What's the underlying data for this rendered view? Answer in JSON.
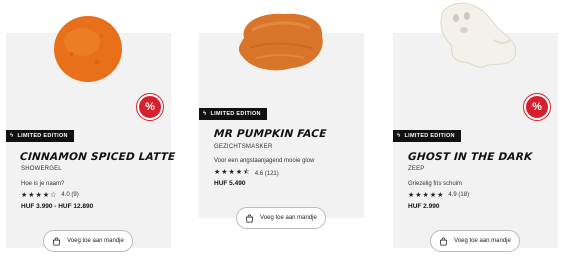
{
  "products": [
    {
      "edition": "LIMITED EDITION",
      "title": "CINNAMON SPICED LATTE",
      "category": "SHOWERGEL",
      "description": "Hoe is je naam?",
      "stars": 4,
      "rating_text": "4.0 (9)",
      "price": "HUF 3.990 - HUF 12.890",
      "cart_label": "Voeg toe aan mandje",
      "badge": "%",
      "image_color": "#e8701a"
    },
    {
      "edition": "LIMITED EDITION",
      "title": "MR PUMPKIN FACE",
      "category": "GEZICHTSMASKER",
      "description": "Voor een angstaanjagend mooie glow",
      "stars": 4.5,
      "rating_text": "4.6 (121)",
      "price": "HUF 5.490",
      "cart_label": "Voeg toe aan mandje",
      "image_color": "#d9752b"
    },
    {
      "edition": "LIMITED EDITION",
      "title": "GHOST IN THE DARK",
      "category": "ZEEP",
      "description": "Griezelig fris schuim",
      "stars": 5,
      "rating_text": "4.9 (18)",
      "price": "HUF 2.990",
      "cart_label": "Voeg toe aan mandje",
      "badge": "%",
      "image_color": "#f3f1ea"
    }
  ],
  "icons": {
    "edition": "lightning-icon",
    "cart": "shopping-bag-icon",
    "badge": "percent-badge-icon"
  }
}
